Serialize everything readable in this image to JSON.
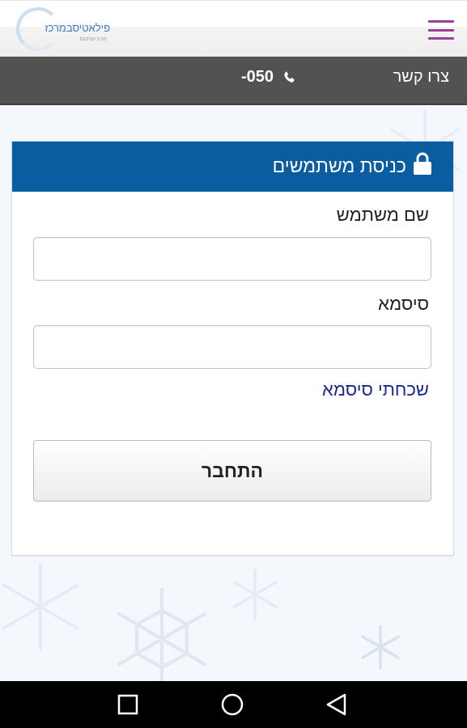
{
  "header": {
    "logo_name": "פילאטיסבמרכז",
    "logo_tagline": "מכון ושיקום",
    "menu_icon": "hamburger-menu-icon",
    "menu_color": "#9b3f98"
  },
  "contact_bar": {
    "label": "צרו קשר",
    "phone": "-050",
    "phone_icon": "phone-icon"
  },
  "login": {
    "title": "כניסת משתמשים",
    "title_icon": "lock-icon",
    "username_label": "שם משתמש",
    "username_value": "",
    "password_label": "סיסמא",
    "password_value": "",
    "forgot_link": "שכחתי סיסמא",
    "submit_label": "התחבר",
    "header_color": "#0a5da1",
    "link_color": "#1c2a8f"
  },
  "android_nav": {
    "recents_icon": "square-recents-icon",
    "home_icon": "circle-home-icon",
    "back_icon": "triangle-back-icon"
  }
}
